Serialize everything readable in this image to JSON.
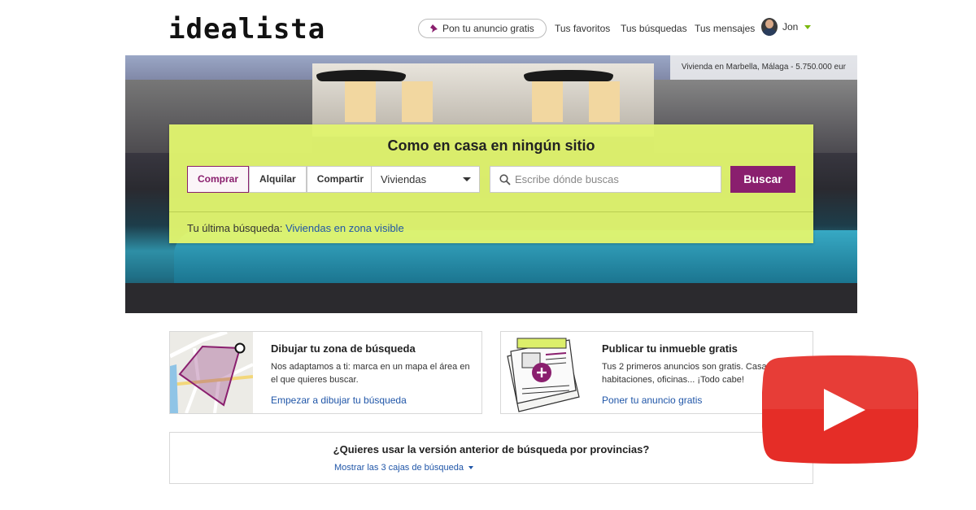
{
  "header": {
    "logo": "idealista",
    "post_ad_label": "Pon tu anuncio gratis",
    "nav": {
      "favorites": "Tus favoritos",
      "searches": "Tus búsquedas",
      "messages": "Tus mensajes"
    },
    "user_name": "Jon"
  },
  "hero": {
    "caption": "Vivienda en Marbella, Málaga - 5.750.000 eur"
  },
  "search": {
    "title": "Como en casa en ningún sitio",
    "operations": [
      "Comprar",
      "Alquilar",
      "Compartir"
    ],
    "active_operation": "Comprar",
    "property_type": "Viviendas",
    "placeholder": "Escribe dónde buscas",
    "button": "Buscar",
    "last_search_label": "Tu última búsqueda:",
    "last_search_link": "Viviendas en zona visible"
  },
  "cards": {
    "draw": {
      "title": "Dibujar tu zona de búsqueda",
      "text": "Nos adaptamos a ti: marca en un mapa el área en el que quieres buscar.",
      "link": "Empezar a dibujar tu búsqueda"
    },
    "publish": {
      "title": "Publicar tu inmueble gratis",
      "text": "Tus 2 primeros anuncios son gratis. Casas, habitaciones, oficinas... ¡Todo cabe!",
      "link": "Poner tu anuncio gratis"
    }
  },
  "provinces": {
    "question": "¿Quieres usar la versión anterior de búsqueda por provincias?",
    "link": "Mostrar las 3 cajas de búsqueda"
  },
  "colors": {
    "brand": "#8a1f6e",
    "panel": "#e1f56e",
    "link": "#2056a8",
    "youtube": "#e52d27"
  },
  "icons": [
    "pin-icon",
    "avatar",
    "chevron-down-icon",
    "search-icon",
    "map-draw-icon",
    "publish-plus-icon",
    "youtube-play-icon"
  ]
}
